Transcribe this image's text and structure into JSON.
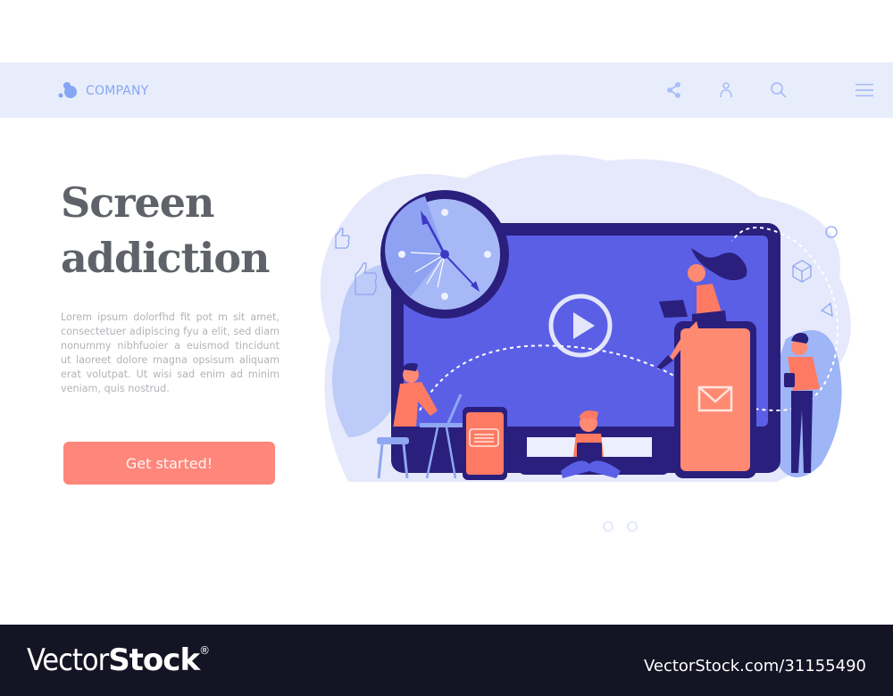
{
  "header": {
    "logo_text": "COMPANY",
    "icons": [
      "share-icon",
      "user-icon",
      "search-icon",
      "menu-icon"
    ]
  },
  "hero": {
    "headline_line1": "Screen",
    "headline_line2": "addiction",
    "body": "Lorem ipsum dolorfhd fit pot m sit amet, consectetuer adipiscing fyu a elit, sed diam nonummy nibhfuoier a euismod tincidunt ut laoreet dolore magna opsisum aliquam erat volutpat. Ut wisi sad enim ad minim veniam, quis nostrud.",
    "cta_label": "Get started!"
  },
  "illustration": {
    "description": "People using laptops, tablets and phones around a large monitor with a play button and a wall clock",
    "elements": [
      "clock-icon",
      "monitor",
      "play-icon",
      "chat-bubble-icon",
      "envelope-icon",
      "thumbs-up-icon",
      "cube-icon",
      "triangle-icon",
      "circle-icon"
    ]
  },
  "carousel": {
    "dots": 2
  },
  "footer": {
    "brand_light": "Vector",
    "brand_bold": "Stock",
    "brand_mark": "®",
    "image_id": "VectorStock.com/31155490"
  },
  "colors": {
    "navbar_bg": "#e8edfc",
    "accent_blue": "#86a6f4",
    "cta": "#ff867b",
    "headline": "#5f6369",
    "body_text": "#b1b4b8",
    "monitor_frame": "#2a1f7d",
    "monitor_screen": "#5b5fe6",
    "coral": "#ff7a63",
    "footer_bg": "#141425"
  }
}
